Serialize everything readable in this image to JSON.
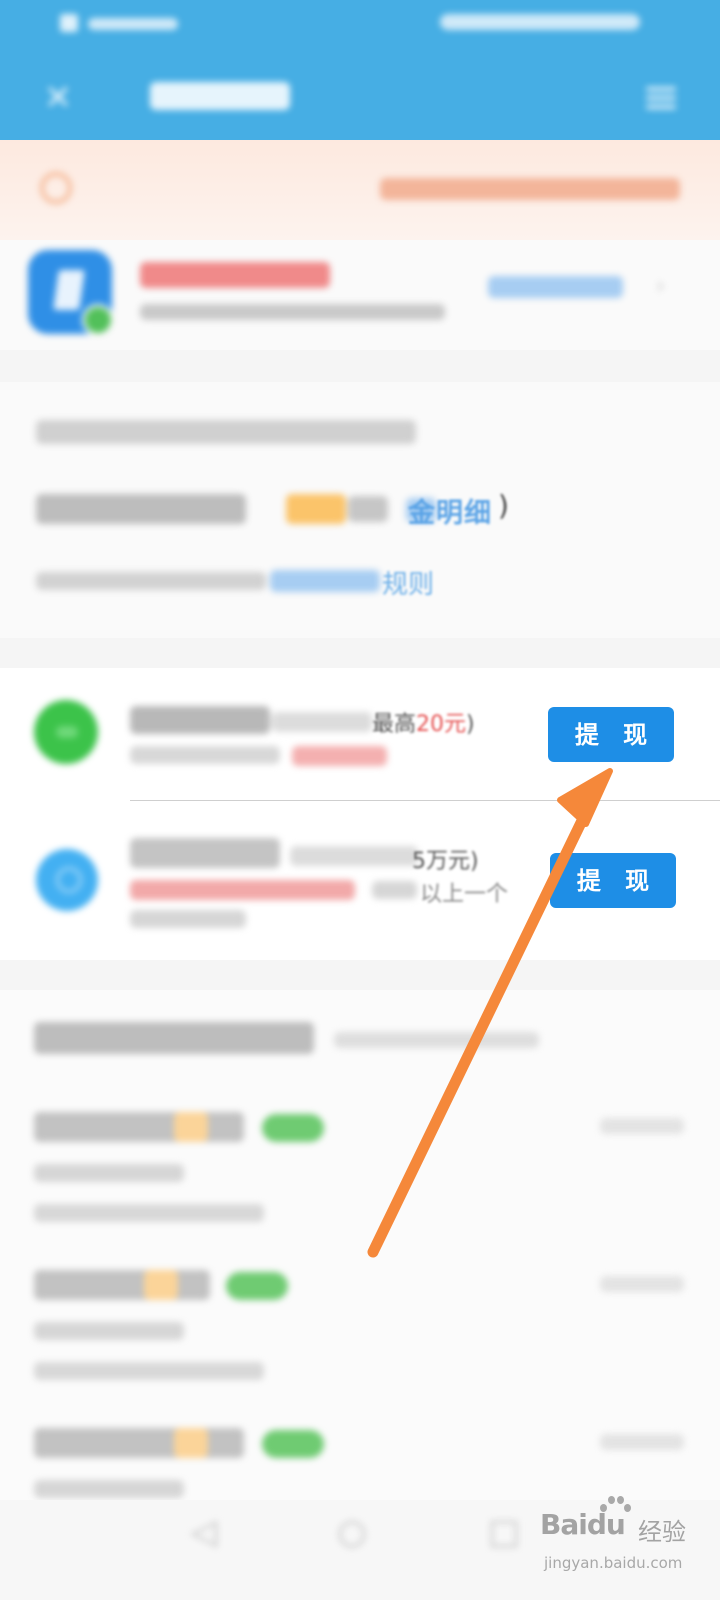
{
  "withdraw": {
    "wechat": {
      "limit_prefix": "最高",
      "limit_amount": "20元",
      "limit_suffix": ")",
      "button_label": "提 现"
    },
    "alipay": {
      "limit_text": "5万元)",
      "hint": "以上一个",
      "button_label": "提 现"
    }
  },
  "balance": {
    "detail_link": "金明细",
    "close_paren": ")",
    "rule_word": "规则"
  },
  "watermark": {
    "logo": "Baidu",
    "cn": "经验",
    "url": "jingyan.baidu.com"
  },
  "colors": {
    "header_blue": "#46aee4",
    "button_blue": "#1e8ee6",
    "arrow_orange": "#f5883a",
    "accent_red": "#e55353"
  },
  "icons": {
    "close": "close-icon",
    "menu": "menu-icon",
    "notice": "speaker-icon",
    "promo": "document-check-icon",
    "wechat": "wechat-icon",
    "alipay": "alipay-icon",
    "back": "back-icon",
    "home": "home-icon",
    "recent": "recent-icon"
  }
}
